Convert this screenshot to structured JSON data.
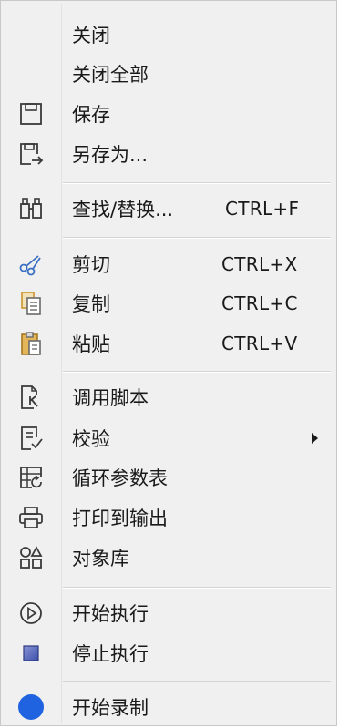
{
  "menu": {
    "items": [
      {
        "id": "close",
        "label": "关闭",
        "shortcut": "",
        "icon": ""
      },
      {
        "id": "close-all",
        "label": "关闭全部",
        "shortcut": "",
        "icon": ""
      },
      {
        "id": "save",
        "label": "保存",
        "shortcut": "",
        "icon": "save-icon"
      },
      {
        "id": "save-as",
        "label": "另存为...",
        "shortcut": "",
        "icon": "save-as-icon"
      },
      {
        "id": "find-replace",
        "label": "查找/替换...",
        "shortcut": "CTRL+F",
        "icon": "binoculars-icon"
      },
      {
        "id": "cut",
        "label": "剪切",
        "shortcut": "CTRL+X",
        "icon": "scissors-icon"
      },
      {
        "id": "copy",
        "label": "复制",
        "shortcut": "CTRL+C",
        "icon": "copy-icon"
      },
      {
        "id": "paste",
        "label": "粘贴",
        "shortcut": "CTRL+V",
        "icon": "paste-icon"
      },
      {
        "id": "call-script",
        "label": "调用脚本",
        "shortcut": "",
        "icon": "call-script-icon"
      },
      {
        "id": "validate",
        "label": "校验",
        "shortcut": "",
        "icon": "validate-icon",
        "submenu": true
      },
      {
        "id": "loop-params",
        "label": "循环参数表",
        "shortcut": "",
        "icon": "loop-table-icon"
      },
      {
        "id": "print-output",
        "label": "打印到输出",
        "shortcut": "",
        "icon": "printer-icon"
      },
      {
        "id": "object-library",
        "label": "对象库",
        "shortcut": "",
        "icon": "object-library-icon"
      },
      {
        "id": "start-run",
        "label": "开始执行",
        "shortcut": "",
        "icon": "play-icon"
      },
      {
        "id": "stop-run",
        "label": "停止执行",
        "shortcut": "",
        "icon": "stop-icon"
      },
      {
        "id": "start-record",
        "label": "开始录制",
        "shortcut": "",
        "icon": "record-icon"
      }
    ]
  },
  "colors": {
    "menu_bg": "#f0f0f0",
    "text": "#1a1a1a",
    "icon_stroke": "#3a3a3a",
    "scissors": "#3a6fc4",
    "record": "#1f63e0",
    "stop": "#3b4fa8",
    "copy_paste": "#c9972e"
  }
}
